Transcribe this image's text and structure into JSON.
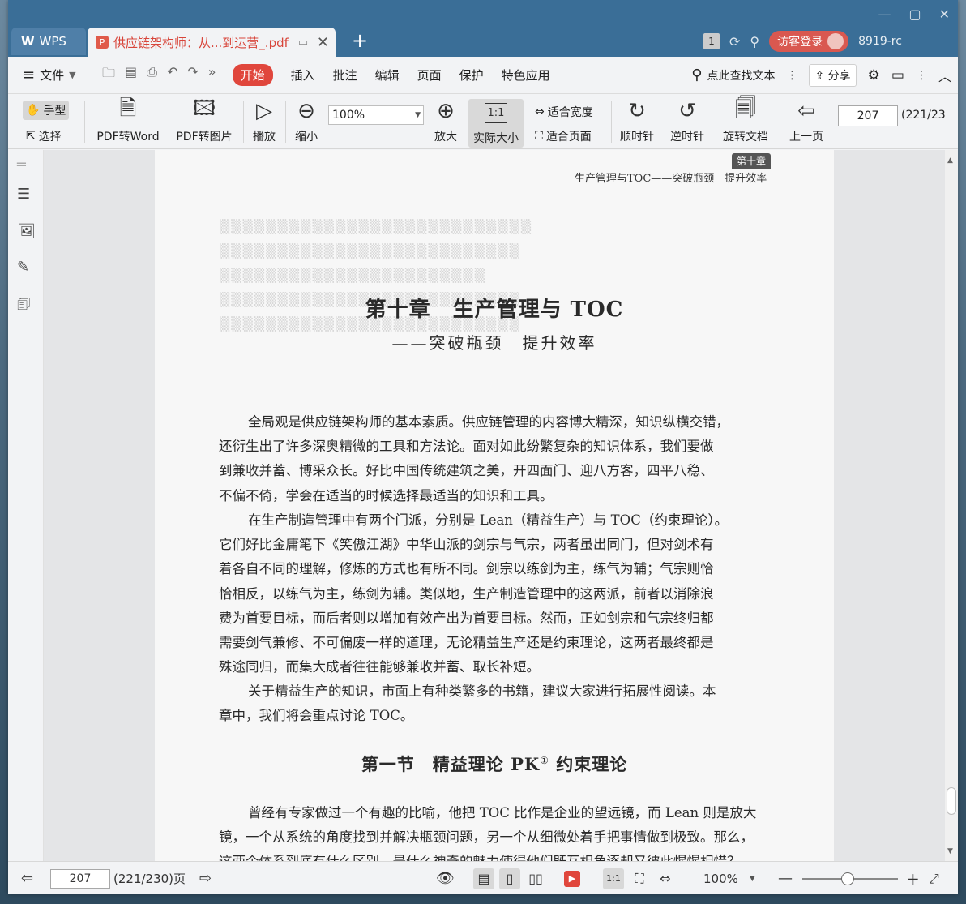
{
  "window_controls": {
    "minimize": "—",
    "maximize": "▢",
    "close": "✕"
  },
  "tabs": {
    "home": {
      "label": "WPS"
    },
    "document": {
      "label": "供应链架构师：从...到运营_.pdf",
      "close": "✕"
    },
    "add": "+"
  },
  "titlebar_right": {
    "page_badge": "1",
    "visitor_login": "访客登录",
    "version": "8919-rc"
  },
  "menu": {
    "file_label": "文件",
    "tabs": [
      "开始",
      "插入",
      "批注",
      "编辑",
      "页面",
      "保护",
      "特色应用"
    ],
    "active_tab": "开始",
    "search_label": "点此查找文本",
    "share_label": "分享"
  },
  "toolbar": {
    "hand": "手型",
    "select": "选择",
    "pdf_to_word": "PDF转Word",
    "pdf_to_image": "PDF转图片",
    "play": "播放",
    "zoom_out": "缩小",
    "zoom_value": "100%",
    "zoom_in": "放大",
    "actual_size": "实际大小",
    "actual_size_icon_text": "1:1",
    "fit_width": "适合宽度",
    "fit_page": "适合页面",
    "clockwise": "顺时针",
    "counterclockwise": "逆时针",
    "rotate_doc": "旋转文档",
    "prev_page": "上一页",
    "page_input": "207",
    "page_total": "(221/23"
  },
  "document": {
    "chapter_badge": "第十章",
    "running_head": "生产管理与TOC——突破瓶颈　提升效率",
    "chapter_title": "第十章　生产管理与 TOC",
    "chapter_subtitle": "——突破瓶颈　提升效率",
    "paragraph1": [
      "全局观是供应链架构师的基本素质。供应链管理的内容博大精深，知识纵横交错，",
      "还衍生出了许多深奥精微的工具和方法论。面对如此纷繁复杂的知识体系，我们要做",
      "到兼收并蓄、博采众长。好比中国传统建筑之美，开四面门、迎八方客，四平八稳、",
      "不偏不倚，学会在适当的时候选择最适当的知识和工具。"
    ],
    "paragraph2": [
      "在生产制造管理中有两个门派，分别是 Lean（精益生产）与 TOC（约束理论）。",
      "它们好比金庸笔下《笑傲江湖》中华山派的剑宗与气宗，两者虽出同门，但对剑术有",
      "着各自不同的理解，修炼的方式也有所不同。剑宗以练剑为主，练气为辅；气宗则恰",
      "恰相反，以练气为主，练剑为辅。类似地，生产制造管理中的这两派，前者以消除浪",
      "费为首要目标，而后者则以增加有效产出为首要目标。然而，正如剑宗和气宗终归都",
      "需要剑气兼修、不可偏废一样的道理，无论精益生产还是约束理论，这两者最终都是",
      "殊途同归，而集大成者往往能够兼收并蓄、取长补短。"
    ],
    "paragraph3": [
      "关于精益生产的知识，市面上有种类繁多的书籍，建议大家进行拓展性阅读。本",
      "章中，我们将会重点讨论 TOC。"
    ],
    "section_title": "第一节　精益理论 PK",
    "section_title_sup": "①",
    "section_title_tail": " 约束理论",
    "paragraph4": [
      "曾经有专家做过一个有趣的比喻，他把 TOC 比作是企业的望远镜，而 Lean 则是放大",
      "镜，一个从系统的角度找到并解决瓶颈问题，另一个从细微处着手把事情做到极致。那么，",
      "这两个体系到底有什么区别，是什么神奇的魅力使得他们既互相角逐却又彼此惺惺相惜？"
    ]
  },
  "statusbar": {
    "page_input": "207",
    "page_total": "(221/230)页",
    "zoom_value": "100%",
    "zoom_out": "—",
    "zoom_in": "+"
  },
  "accent_colors": {
    "titlebar": "#3a6e97",
    "active_tab": "#e0463c",
    "doc_tab_text": "#d8453a"
  }
}
